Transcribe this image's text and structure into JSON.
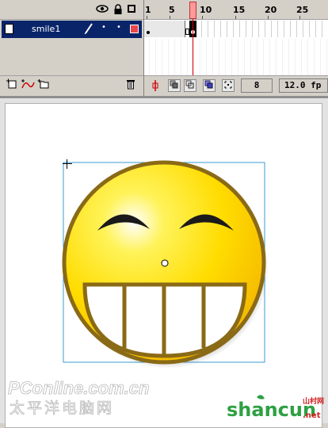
{
  "timeline": {
    "layer_name": "smile1",
    "ruler_ticks": [
      "1",
      "5",
      "10",
      "15",
      "20",
      "25"
    ],
    "current_frame": "8",
    "fps": "12.0 fp",
    "layer_color": "#e8474c",
    "selected_row_color": "#0a246a"
  },
  "icons": {
    "eye": "eye-icon",
    "lock": "lock-icon",
    "outline": "outline-icon",
    "pencil": "pencil-icon",
    "trash": "trash-icon"
  },
  "stage": {
    "smiley_color": "#ffdc00",
    "outline_color": "#8a6a16"
  },
  "watermarks": {
    "left_brand": "PConline.com.cn",
    "left_sub": "太平洋电脑网",
    "right_brand": "shancun",
    "right_suffix": ".net",
    "right_cn": "山村网"
  }
}
